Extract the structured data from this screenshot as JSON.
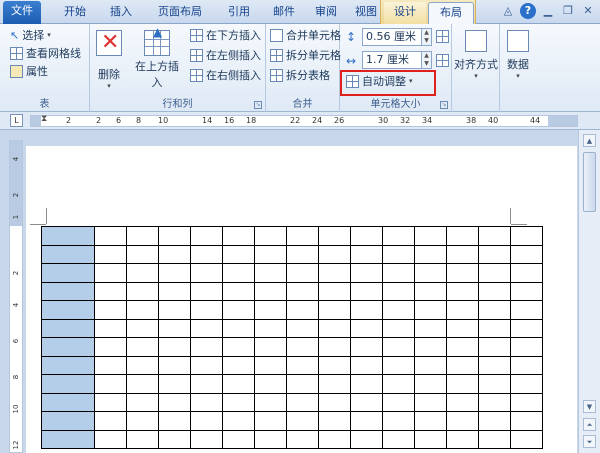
{
  "tabs": [
    {
      "label": "文件",
      "active": false
    },
    {
      "label": "开始",
      "active": false
    },
    {
      "label": "插入",
      "active": false
    },
    {
      "label": "页面布局",
      "active": false
    },
    {
      "label": "引用",
      "active": false
    },
    {
      "label": "邮件",
      "active": false
    },
    {
      "label": "审阅",
      "active": false
    },
    {
      "label": "视图",
      "active": false
    },
    {
      "label": "设计",
      "active": false
    },
    {
      "label": "布局",
      "active": true
    }
  ],
  "ribbon": {
    "table_group": {
      "label": "表",
      "select": "选择",
      "view_gridlines": "查看网格线",
      "properties": "属性"
    },
    "rows_cols_group": {
      "label": "行和列",
      "delete": "删除",
      "insert_above": "在上方插入",
      "insert_below": "在下方插入",
      "insert_left": "在左侧插入",
      "insert_right": "在右侧插入"
    },
    "merge_group": {
      "label": "合并",
      "merge_cells": "合并单元格",
      "split_cells": "拆分单元格",
      "split_table": "拆分表格"
    },
    "cell_size_group": {
      "label": "单元格大小",
      "height_value": "0.56 厘米",
      "width_value": "1.7 厘米",
      "autofit": "自动调整"
    },
    "alignment": "对齐方式",
    "data": "数据"
  },
  "ruler": {
    "tab_selector": "L",
    "h_numbers": [
      "2",
      "2",
      "6",
      "8",
      "10",
      "14",
      "16",
      "18",
      "22",
      "24",
      "26",
      "30",
      "32",
      "34",
      "38",
      "40",
      "44"
    ],
    "v_numbers": [
      "4",
      "2",
      "1",
      "2",
      "4",
      "6",
      "8",
      "10",
      "12"
    ]
  },
  "table": {
    "rows": 12,
    "cols": 15
  },
  "colors": {
    "selection": "#b4cde8",
    "highlight": "#e0201c",
    "file_tab": "#2b6fc4"
  }
}
